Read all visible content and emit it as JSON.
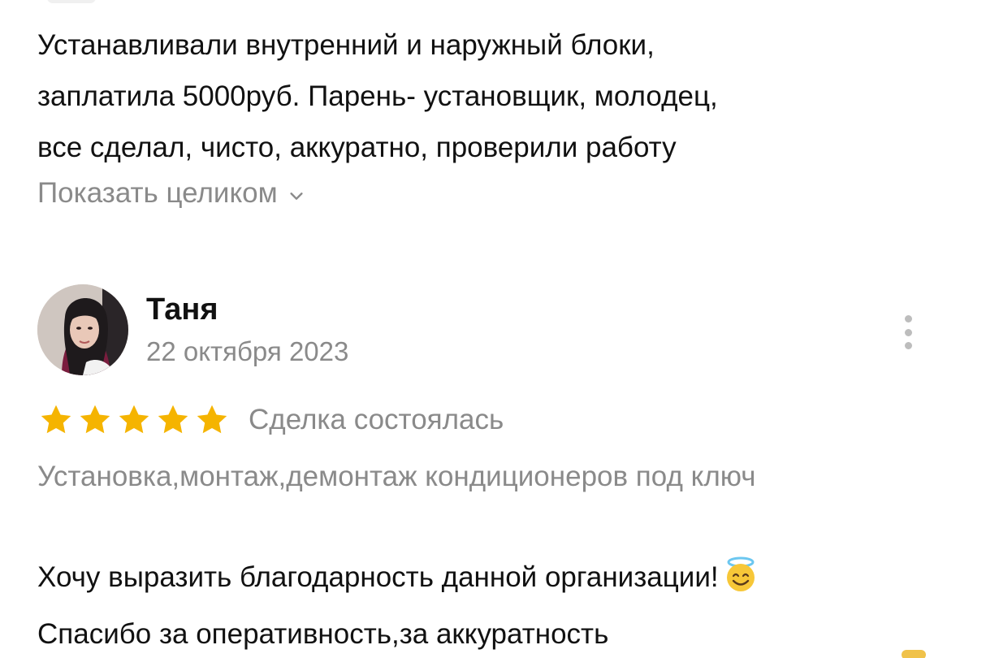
{
  "previous_review": {
    "lines": [
      "Устанавливали внутренний и наружный блоки,",
      "заплатила 5000руб. Парень- установщик, молодец,",
      "все сделал, чисто, аккуратно, проверили работу"
    ],
    "show_more_label": "Показать целиком",
    "show_more_icon": "chevron-down-icon"
  },
  "review": {
    "author": "Таня",
    "date": "22 октября 2023",
    "rating": 5,
    "rating_max": 5,
    "deal_status": "Сделка состоялась",
    "service_category": "Установка,монтаж,демонтаж кондиционеров под ключ",
    "text_lines": [
      "Хочу выразить благодарность данной организации!",
      "Спасибо за оперативность,за аккуратность"
    ],
    "emoji": "smiling-face-with-halo",
    "menu_icon": "more-vertical-icon"
  },
  "colors": {
    "text": "#111111",
    "muted": "#8a8a8a",
    "star": "#f5b400",
    "menu_dots": "#bdbdbd"
  }
}
